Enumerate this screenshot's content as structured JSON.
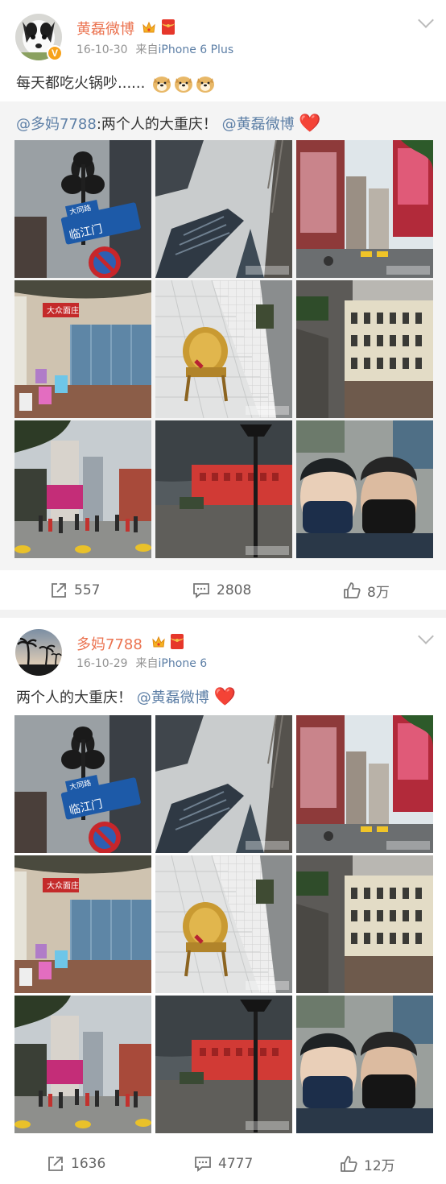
{
  "posts": [
    {
      "user": {
        "name": "黄磊微博",
        "avatar_icon": "dog-avatar",
        "verified_icon": "verified-v-icon"
      },
      "time": "16-10-30",
      "source_prefix": "来自",
      "device": "iPhone 6 Plus",
      "text": "每天都吃火锅吵......",
      "emoji_icons": [
        "doge-emoji",
        "doge-emoji",
        "doge-emoji"
      ],
      "repost": {
        "author": "@多妈7788",
        "colon": ":",
        "text": "两个人的大重庆！",
        "mention": "@黄磊微博",
        "heart": "❤️"
      },
      "stats": {
        "reposts": "557",
        "comments": "2808",
        "likes": "8万"
      }
    },
    {
      "user": {
        "name": "多妈7788",
        "avatar_icon": "palm-tree-sunset-avatar"
      },
      "time": "16-10-29",
      "source_prefix": "来自",
      "device": "iPhone 6",
      "text": "两个人的大重庆！",
      "mention": "@黄磊微博",
      "heart": "❤️",
      "stats": {
        "reposts": "1636",
        "comments": "4777",
        "likes": "12万"
      }
    }
  ],
  "photos": [
    {
      "subject": "street-lamp-sign-photo",
      "sign_lines": [
        "大同路",
        "临江门"
      ]
    },
    {
      "subject": "skyscrapers-looking-up-photo"
    },
    {
      "subject": "shopping-street-photo"
    },
    {
      "subject": "street-food-stall-stools-photo",
      "sign": "大众面庄"
    },
    {
      "subject": "rattan-chair-photo"
    },
    {
      "subject": "colonial-building-photo"
    },
    {
      "subject": "pedestrian-street-crowd-photo"
    },
    {
      "subject": "red-building-lamp-photo"
    },
    {
      "subject": "selfie-masks-photo"
    }
  ],
  "colors": {
    "name": "#eb7350",
    "link": "#5d7fa6",
    "meta": "#939393",
    "heart": "#e0142d"
  }
}
